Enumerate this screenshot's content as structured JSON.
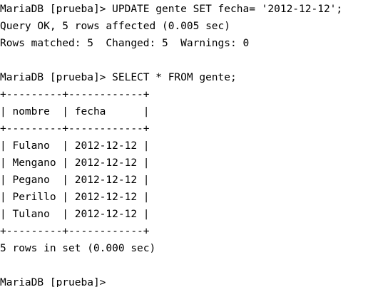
{
  "terminal": {
    "lines": [
      "MariaDB [prueba]> UPDATE gente SET fecha= '2012-12-12';",
      "Query OK, 5 rows affected (0.005 sec)",
      "Rows matched: 5  Changed: 5  Warnings: 0",
      "",
      "MariaDB [prueba]> SELECT * FROM gente;",
      "+---------+------------+",
      "| nombre  | fecha      |",
      "+---------+------------+",
      "| Fulano  | 2012-12-12 |",
      "| Mengano | 2012-12-12 |",
      "| Pegano  | 2012-12-12 |",
      "| Perillo | 2012-12-12 |",
      "| Tulano  | 2012-12-12 |",
      "+---------+------------+",
      "5 rows in set (0.000 sec)",
      "",
      "MariaDB [prueba]>"
    ]
  }
}
